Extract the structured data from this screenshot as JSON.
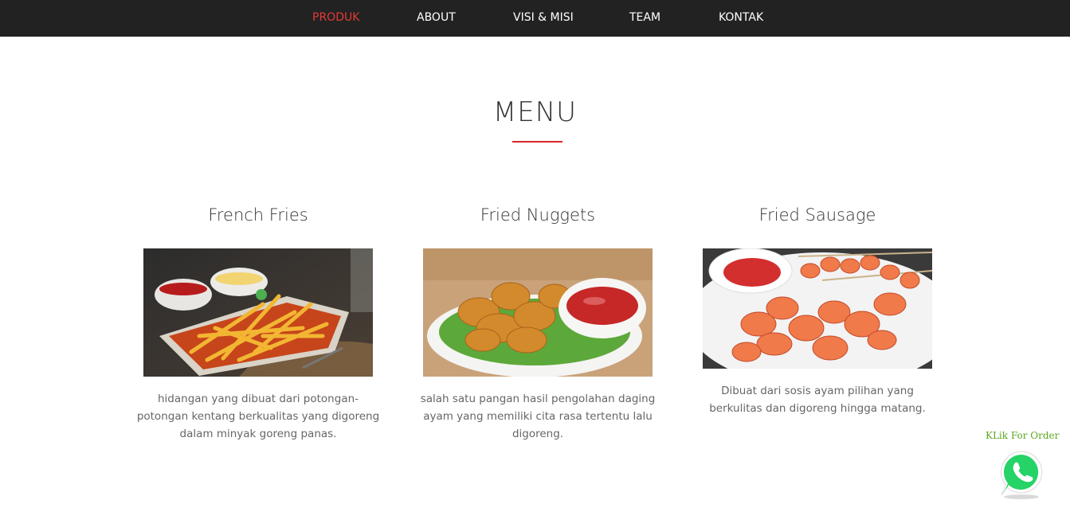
{
  "nav": {
    "items": [
      {
        "label": "PRODUK",
        "active": true
      },
      {
        "label": "ABOUT",
        "active": false
      },
      {
        "label": "VISI & MISI",
        "active": false
      },
      {
        "label": "TEAM",
        "active": false
      },
      {
        "label": "KONTAK",
        "active": false
      }
    ],
    "active_color": "#e53935",
    "background": "#222222"
  },
  "section": {
    "title": "MENU",
    "accent_color": "#d9262b"
  },
  "menu": {
    "items": [
      {
        "title": "French Fries",
        "description": "hidangan yang dibuat dari potongan-potongan kentang berkualitas yang digoreng dalam minyak goreng panas."
      },
      {
        "title": "Fried Nuggets",
        "description": "salah satu pangan hasil pengolahan daging ayam yang memiliki cita rasa tertentu lalu digoreng."
      },
      {
        "title": "Fried Sausage",
        "description": "Dibuat dari sosis ayam pilihan yang berkulitas dan digoreng hingga matang."
      }
    ]
  },
  "whatsapp": {
    "label": "KLik For Order",
    "icon": "whatsapp-icon",
    "color": "#25d366"
  }
}
